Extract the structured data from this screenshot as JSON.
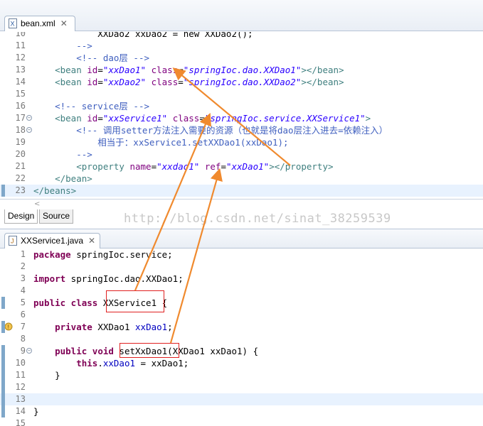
{
  "xml_tab": {
    "title": "bean.xml",
    "close": "✕"
  },
  "java_tab": {
    "title": "XXService1.java",
    "close": "✕"
  },
  "xml_lines": [
    {
      "num": "10",
      "tokens": [
        [
          "t-plain",
          "            XXDao2 xxDao2 = new XXDao2();"
        ]
      ]
    },
    {
      "num": "11",
      "tokens": [
        [
          "t-cmt",
          "        -->"
        ]
      ]
    },
    {
      "num": "12",
      "tokens": [
        [
          "t-cmt",
          "        <!-- dao层 -->"
        ]
      ]
    },
    {
      "num": "13",
      "tokens": [
        [
          "t-tag",
          "    <bean "
        ],
        [
          "t-attr",
          "id"
        ],
        [
          "t-plain",
          "="
        ],
        [
          "t-val",
          "\"xxDao1\""
        ],
        [
          "t-plain",
          " "
        ],
        [
          "t-attr",
          "class"
        ],
        [
          "t-plain",
          "="
        ],
        [
          "t-val",
          "\"springIoc.dao.XXDao1\""
        ],
        [
          "t-tag",
          "></bean>"
        ]
      ]
    },
    {
      "num": "14",
      "tokens": [
        [
          "t-tag",
          "    <bean "
        ],
        [
          "t-attr",
          "id"
        ],
        [
          "t-plain",
          "="
        ],
        [
          "t-val",
          "\"xxDao2\""
        ],
        [
          "t-plain",
          " "
        ],
        [
          "t-attr",
          "class"
        ],
        [
          "t-plain",
          "="
        ],
        [
          "t-val",
          "\"springIoc.dao.XXDao2\""
        ],
        [
          "t-tag",
          "></bean>"
        ]
      ]
    },
    {
      "num": "15",
      "tokens": [
        [
          "t-plain",
          ""
        ]
      ]
    },
    {
      "num": "16",
      "tokens": [
        [
          "t-cmt",
          "    <!-- service层 -->"
        ]
      ]
    },
    {
      "num": "17",
      "tokens": [
        [
          "t-tag",
          "    <bean "
        ],
        [
          "t-attr",
          "id"
        ],
        [
          "t-plain",
          "="
        ],
        [
          "t-val",
          "\"xxService1\""
        ],
        [
          "t-plain",
          " "
        ],
        [
          "t-attr",
          "class"
        ],
        [
          "t-plain",
          "="
        ],
        [
          "t-val",
          "\"springIoc.service.XXService1\""
        ],
        [
          "t-tag",
          ">"
        ]
      ],
      "fold": "⊖"
    },
    {
      "num": "18",
      "tokens": [
        [
          "t-cmt",
          "        <!-- 调用setter方法注入需要的资源（也就是将dao层注入进去=依赖注入）"
        ]
      ],
      "fold": "⊖"
    },
    {
      "num": "19",
      "tokens": [
        [
          "t-cmt",
          "            相当于：xxService1.setXXDao1(xxDao1);"
        ]
      ]
    },
    {
      "num": "20",
      "tokens": [
        [
          "t-cmt",
          "        -->"
        ]
      ]
    },
    {
      "num": "21",
      "tokens": [
        [
          "t-tag",
          "        <property "
        ],
        [
          "t-attr",
          "name"
        ],
        [
          "t-plain",
          "="
        ],
        [
          "t-val",
          "\"xxdao1\""
        ],
        [
          "t-plain",
          " "
        ],
        [
          "t-attr",
          "ref"
        ],
        [
          "t-plain",
          "="
        ],
        [
          "t-val",
          "\"xxDao1\""
        ],
        [
          "t-tag",
          "></property>"
        ]
      ]
    },
    {
      "num": "22",
      "tokens": [
        [
          "t-tag",
          "    </bean>"
        ]
      ]
    },
    {
      "num": "23",
      "tokens": [
        [
          "t-tag",
          "</beans>"
        ]
      ],
      "current": true
    }
  ],
  "java_lines": [
    {
      "num": "1",
      "tokens": [
        [
          "t-kw",
          "package"
        ],
        [
          "t-plain",
          " springIoc.service;"
        ]
      ]
    },
    {
      "num": "2",
      "tokens": [
        [
          "t-plain",
          ""
        ]
      ]
    },
    {
      "num": "3",
      "tokens": [
        [
          "t-kw",
          "import"
        ],
        [
          "t-plain",
          " springIoc.dao.XXDao1;"
        ]
      ]
    },
    {
      "num": "4",
      "tokens": [
        [
          "t-plain",
          ""
        ]
      ]
    },
    {
      "num": "5",
      "tokens": [
        [
          "t-kw",
          "public class"
        ],
        [
          "t-plain",
          " XXService1 {"
        ]
      ]
    },
    {
      "num": "6",
      "tokens": [
        [
          "t-plain",
          ""
        ]
      ]
    },
    {
      "num": "7",
      "tokens": [
        [
          "t-plain",
          "    "
        ],
        [
          "t-kw",
          "private"
        ],
        [
          "t-plain",
          " XXDao1 "
        ],
        [
          "t-fld",
          "xxDao1"
        ],
        [
          "t-plain",
          ";"
        ]
      ]
    },
    {
      "num": "8",
      "tokens": [
        [
          "t-plain",
          ""
        ]
      ]
    },
    {
      "num": "9",
      "tokens": [
        [
          "t-plain",
          "    "
        ],
        [
          "t-kw",
          "public void"
        ],
        [
          "t-plain",
          " setXxDao1(XXDao1 xxDao1) {"
        ]
      ],
      "fold": "⊖"
    },
    {
      "num": "10",
      "tokens": [
        [
          "t-plain",
          "        "
        ],
        [
          "t-kw",
          "this"
        ],
        [
          "t-plain",
          "."
        ],
        [
          "t-fld",
          "xxDao1"
        ],
        [
          "t-plain",
          " = xxDao1;"
        ]
      ]
    },
    {
      "num": "11",
      "tokens": [
        [
          "t-plain",
          "    }"
        ]
      ]
    },
    {
      "num": "12",
      "tokens": [
        [
          "t-plain",
          ""
        ]
      ]
    },
    {
      "num": "13",
      "tokens": [
        [
          "t-plain",
          "    "
        ]
      ],
      "current": true
    },
    {
      "num": "14",
      "tokens": [
        [
          "t-plain",
          "}"
        ]
      ]
    },
    {
      "num": "15",
      "tokens": [
        [
          "t-plain",
          ""
        ]
      ]
    }
  ],
  "mode_tabs": {
    "design": "Design",
    "source": "Source"
  },
  "watermark": "http://blog.csdn.net/sinat_38259539",
  "colors": {
    "arrow": "#f08a2e",
    "highlight_box": "#e02020"
  }
}
